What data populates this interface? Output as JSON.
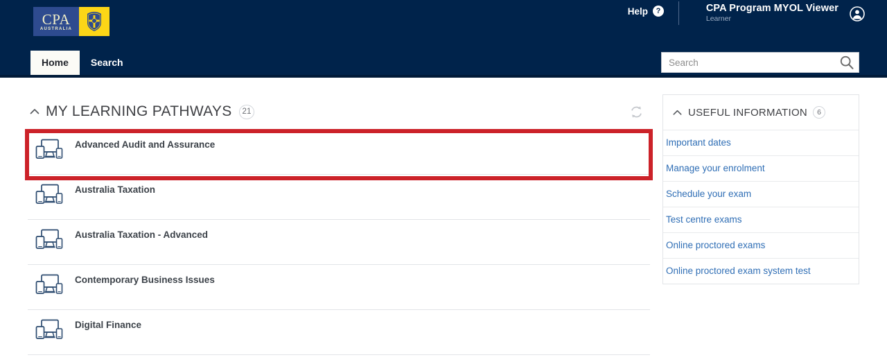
{
  "brand": {
    "logo_text": "CPA",
    "logo_subtext": "AUSTRALIA",
    "logo_blue": "#2e4b8f",
    "logo_yellow": "#fcd617",
    "crest_icon": "crest-emblem-icon"
  },
  "header": {
    "background": "#00234b",
    "help_label": "Help",
    "help_icon": "question-mark-circle-icon",
    "app_title": "CPA Program MYOL Viewer",
    "app_subtitle": "Learner",
    "avatar_icon": "user-avatar-icon",
    "tabs": [
      {
        "label": "Home",
        "active": true
      },
      {
        "label": "Search",
        "active": false
      }
    ],
    "search": {
      "value": "",
      "placeholder": "Search",
      "icon": "search-icon"
    }
  },
  "pathways_panel": {
    "collapse_icon": "chevron-up-icon",
    "title": "MY LEARNING PATHWAYS",
    "count": "21",
    "refresh_icon": "refresh-icon",
    "items": [
      {
        "label": "Advanced Audit and Assurance",
        "icon": "multi-device-icon",
        "highlighted": true
      },
      {
        "label": "Australia Taxation",
        "icon": "multi-device-icon",
        "highlighted": false
      },
      {
        "label": "Australia Taxation - Advanced",
        "icon": "multi-device-icon",
        "highlighted": false
      },
      {
        "label": "Contemporary Business Issues",
        "icon": "multi-device-icon",
        "highlighted": false
      },
      {
        "label": "Digital Finance",
        "icon": "multi-device-icon",
        "highlighted": false
      }
    ],
    "highlight_color": "#cc2229"
  },
  "info_panel": {
    "collapse_icon": "chevron-up-icon",
    "title": "USEFUL INFORMATION",
    "count": "6",
    "link_color": "#2f6eb5",
    "links": [
      {
        "label": "Important dates"
      },
      {
        "label": "Manage your enrolment"
      },
      {
        "label": "Schedule your exam"
      },
      {
        "label": "Test centre exams"
      },
      {
        "label": "Online proctored exams"
      },
      {
        "label": "Online proctored exam system test"
      }
    ]
  }
}
